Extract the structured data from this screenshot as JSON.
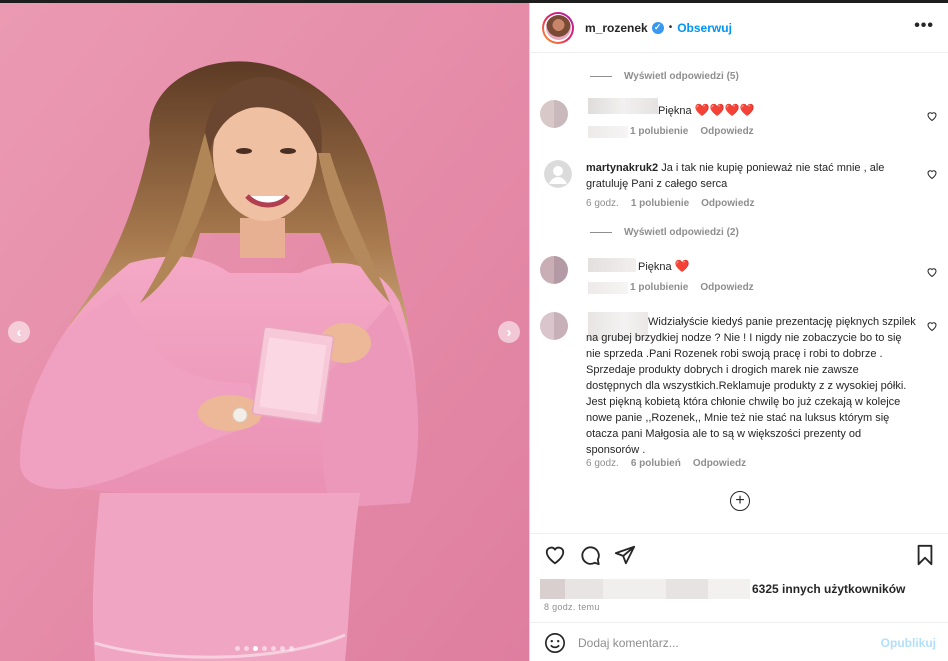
{
  "header": {
    "username": "m_rozenek",
    "follow_label": "Obserwuj",
    "separator": "•",
    "more_label": "•••"
  },
  "comments": {
    "view_replies_1": "Wyświetl odpowiedzi (5)",
    "view_replies_2": "Wyświetl odpowiedzi (2)",
    "items": [
      {
        "text": "Piękna",
        "hearts": "❤️❤️❤️❤️",
        "likes": "1 polubienie",
        "reply": "Odpowiedz"
      },
      {
        "username": "martynakruk2",
        "text": "Ja i tak nie kupię ponieważ nie stać mnie , ale gratuluję Pani z całego serca",
        "time": "6 godz.",
        "likes": "1 polubienie",
        "reply": "Odpowiedz"
      },
      {
        "text": "Piękna",
        "hearts": "❤️",
        "likes": "1 polubienie",
        "reply": "Odpowiedz"
      },
      {
        "text": "Widziałyście kiedyś panie prezentację pięknych szpilek na grubej brzydkiej nodze ? Nie ! I nigdy nie zobaczycie bo to się nie sprzeda .Pani Rozenek robi swoją pracę i robi to dobrze . Sprzedaje produkty dobrych i drogich marek nie zawsze dostępnych dla wszystkich.Reklamuje produkty z z wysokiej półki. Jest piękną kobietą która chłonie chwilę bo już czekają w kolejce nowe panie ,,Rozenek,, Mnie też nie stać na luksus którym się otacza pani Małgosia ale to są w większości prezenty od sponsorów .",
        "time": "6 godz.",
        "likes": "6 polubień",
        "reply": "Odpowiedz"
      }
    ]
  },
  "actions": {
    "likes_text": "6325 innych użytkowników",
    "time": "8 godz. temu",
    "comment_placeholder": "Dodaj komentarz...",
    "publish_label": "Opublikuj"
  },
  "colors": {
    "accent": "#0095f6",
    "heart": "#ed4956",
    "photo_background": "#e88fac"
  },
  "carousel": {
    "total_slides": 7,
    "active_slide": 3
  }
}
